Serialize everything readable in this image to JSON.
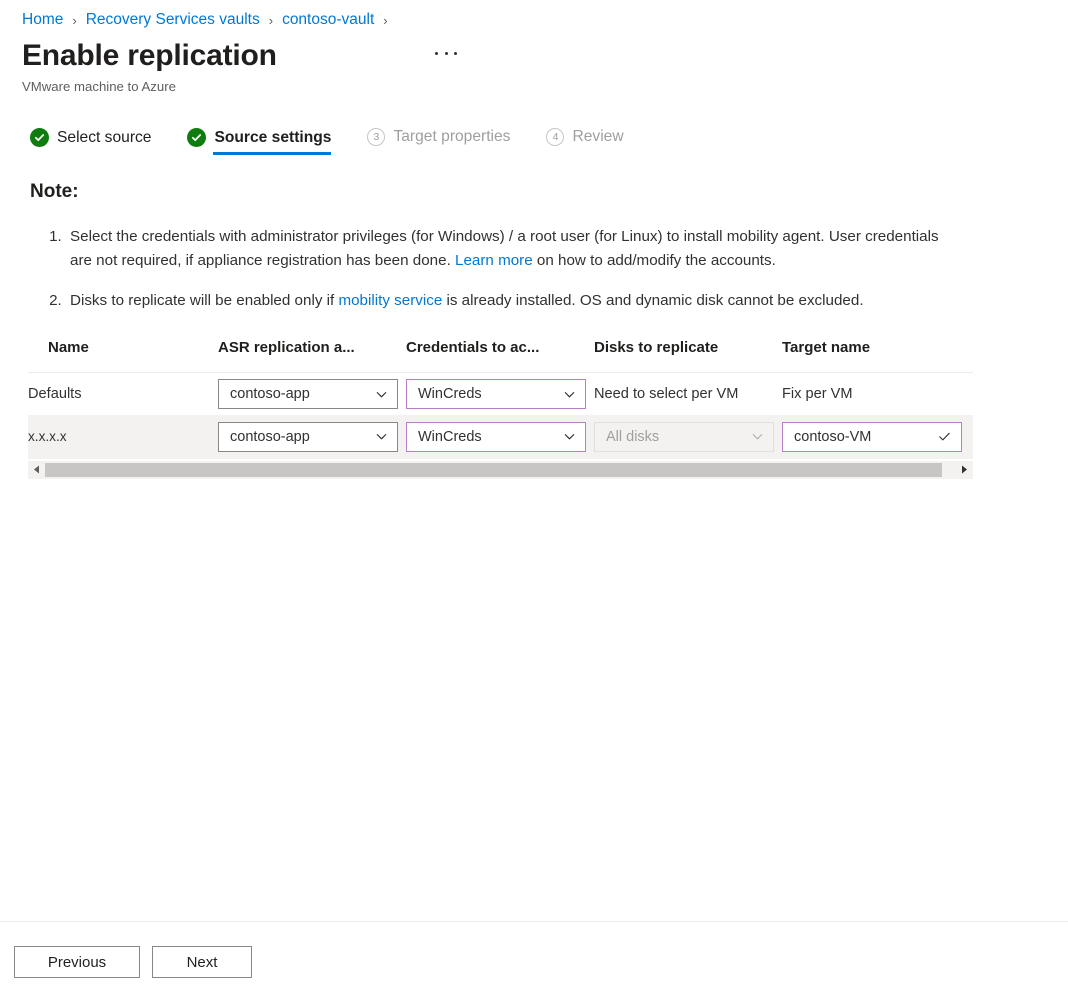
{
  "breadcrumb": {
    "items": [
      {
        "label": "Home"
      },
      {
        "label": "Recovery Services vaults"
      },
      {
        "label": "contoso-vault"
      }
    ],
    "separator": "›"
  },
  "header": {
    "title": "Enable replication",
    "subtitle": "VMware machine to Azure",
    "more_menu": "..."
  },
  "wizard": {
    "steps": [
      {
        "label": "Select source",
        "state": "done",
        "marker": "✓"
      },
      {
        "label": "Source settings",
        "state": "active",
        "marker": "✓"
      },
      {
        "label": "Target properties",
        "state": "todo",
        "marker": "3"
      },
      {
        "label": "Review",
        "state": "todo",
        "marker": "4"
      }
    ]
  },
  "note": {
    "heading": "Note:",
    "items": [
      {
        "text_before": "Select the credentials with administrator privileges (for Windows) / a root user (for Linux) to install mobility agent. User credentials are not required, if appliance registration has been done. ",
        "link": "Learn more",
        "text_after": " on how to add/modify the accounts."
      },
      {
        "text_before": "Disks to replicate will be enabled only if ",
        "link": "mobility service",
        "text_after": " is already installed. OS and dynamic disk cannot be excluded."
      }
    ]
  },
  "table": {
    "columns": [
      "Name",
      "ASR replication a...",
      "Credentials to ac...",
      "Disks to replicate",
      "Target name"
    ],
    "rows": {
      "defaults": {
        "name": "Defaults",
        "asr_replication_policy": "contoso-app",
        "credentials": "WinCreds",
        "disks_to_replicate": "Need to select per VM",
        "target_name": "Fix per VM"
      },
      "vm": {
        "name": "x.x.x.x",
        "asr_replication_policy": "contoso-app",
        "credentials": "WinCreds",
        "disks_to_replicate": "All disks",
        "target_name": "contoso-VM"
      }
    }
  },
  "footer": {
    "previous_label": "Previous",
    "next_label": "Next"
  },
  "colors": {
    "link": "#0078d4",
    "accent_underline": "#0078d4",
    "step_complete": "#107c10",
    "control_border_highlight": "#b77ec9",
    "control_border_default": "#8a8886",
    "row_selected_bg": "#f3f2f1"
  }
}
